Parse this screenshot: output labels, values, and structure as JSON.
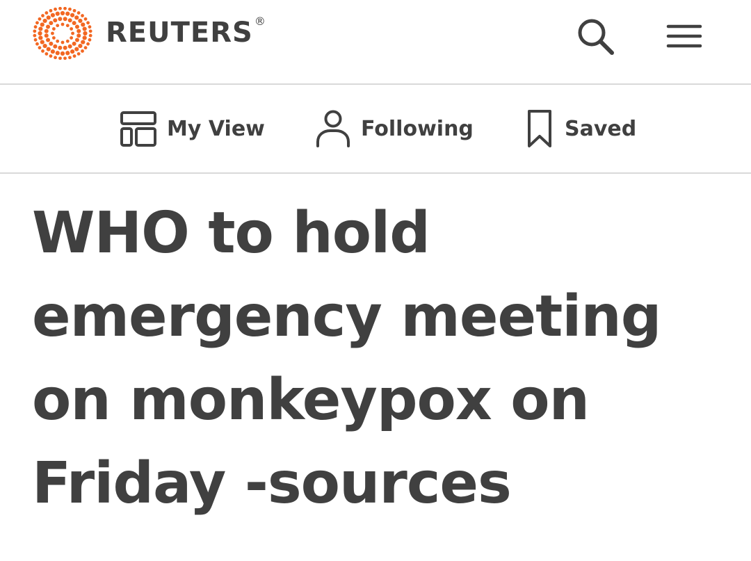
{
  "header": {
    "brand_name": "REUTERS",
    "brand_registered": "®",
    "logo_icon": "reuters-dot-logo",
    "search_icon": "search-icon",
    "menu_icon": "hamburger-menu-icon",
    "logo_color": "#f26722"
  },
  "nav": {
    "items": [
      {
        "label": "My View",
        "icon": "layout-icon"
      },
      {
        "label": "Following",
        "icon": "person-icon"
      },
      {
        "label": "Saved",
        "icon": "bookmark-icon"
      }
    ]
  },
  "article": {
    "headline": "WHO to hold emergency meeting on monkeypox on Friday -sources"
  },
  "colors": {
    "text": "#404040",
    "divider": "#d9d9d9",
    "background": "#ffffff"
  }
}
